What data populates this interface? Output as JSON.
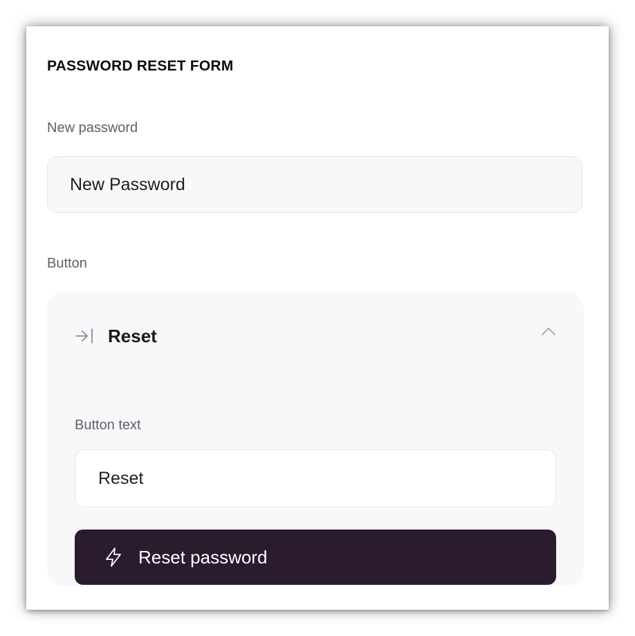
{
  "form": {
    "title": "PASSWORD RESET FORM",
    "new_password_label": "New password",
    "new_password_placeholder": "New Password",
    "button_section_label": "Button"
  },
  "button_card": {
    "title": "Reset",
    "button_text_label": "Button text",
    "button_text_value": "Reset",
    "cta_label": "Reset password",
    "icons": {
      "header": "arrow-to-line-right-icon",
      "toggle": "chevron-up-icon",
      "cta": "lightning-bolt-icon"
    }
  },
  "colors": {
    "cta_background": "#2a1b2e",
    "card_background": "#f8f8fa",
    "input_border": "#e6e6ea",
    "label_text": "#5f5f66"
  }
}
